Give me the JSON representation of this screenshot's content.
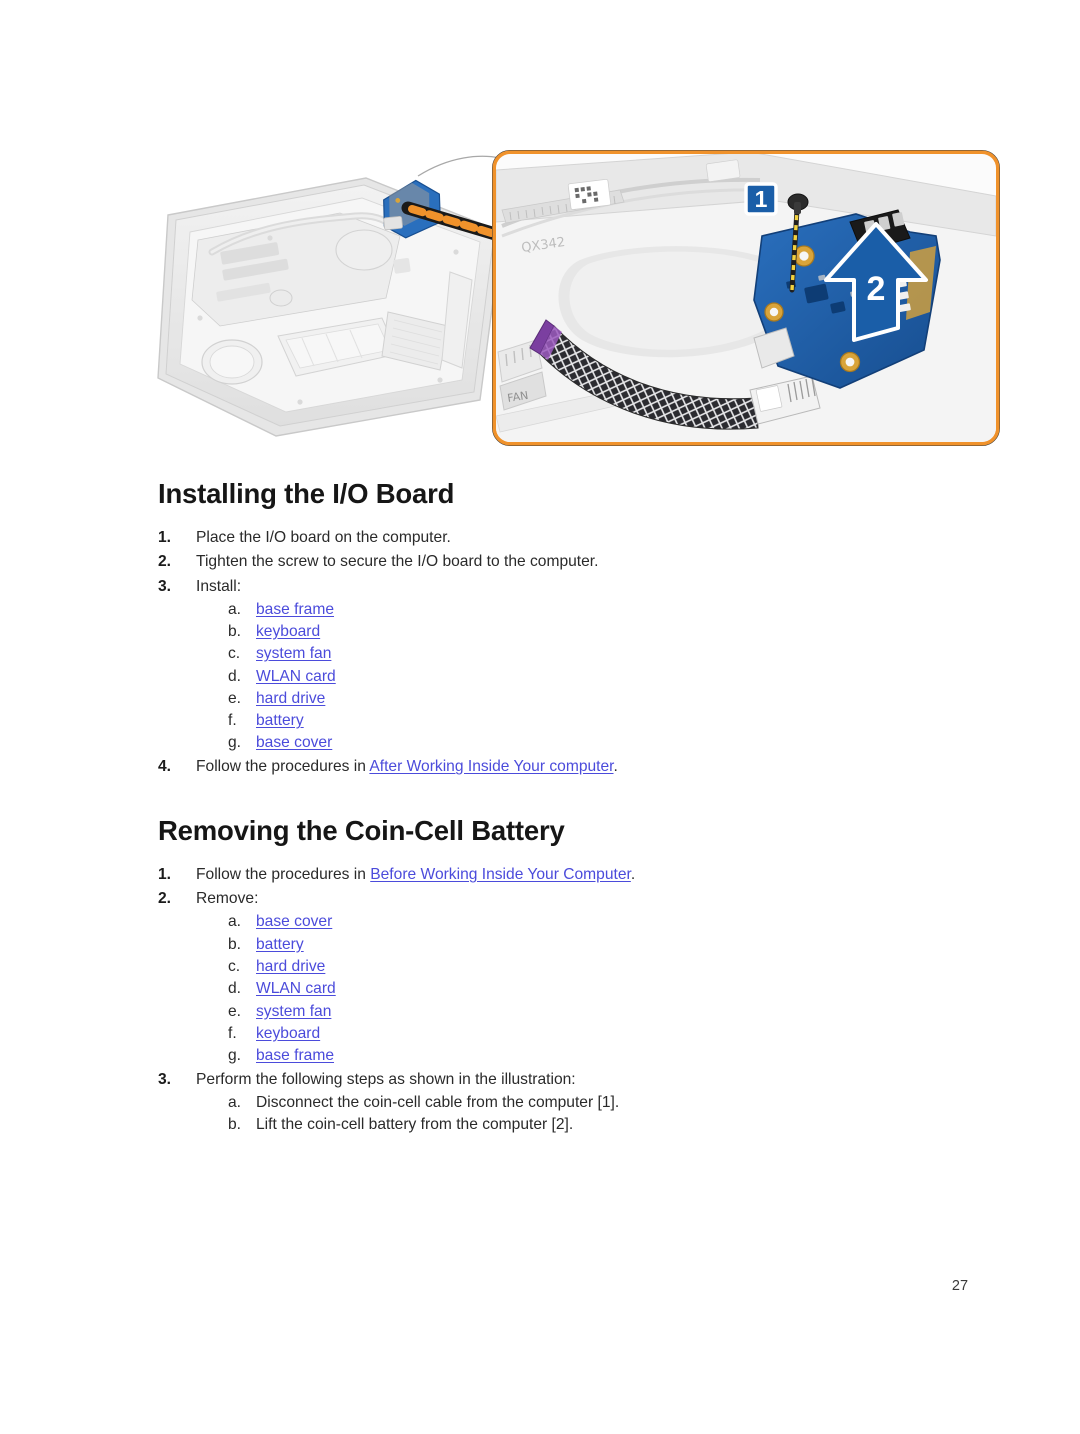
{
  "figure": {
    "alt_description": "Exploded view of laptop base with magnified callout of the coin-cell battery / I-O board area",
    "callout_border_color": "#f0922b",
    "pcb_color": "#1e5fa8",
    "marker_color": "#1a5ea8",
    "markers": [
      {
        "id": "1",
        "label": "1",
        "type": "square-badge"
      },
      {
        "id": "2",
        "label": "2",
        "type": "arrow-up"
      }
    ],
    "chassis_labels": [
      "FAN"
    ]
  },
  "sections": [
    {
      "id": "installing-io-board",
      "title": "Installing the I/O Board",
      "steps": [
        {
          "num": "1.",
          "text": "Place the I/O board on the computer."
        },
        {
          "num": "2.",
          "text": "Tighten the screw to secure the I/O board to the computer."
        },
        {
          "num": "3.",
          "text": "Install:",
          "substeps": [
            {
              "lettr": "a.",
              "text": "base frame",
              "link": true
            },
            {
              "lettr": "b.",
              "text": "keyboard",
              "link": true
            },
            {
              "lettr": "c.",
              "text": "system fan",
              "link": true
            },
            {
              "lettr": "d.",
              "text": "WLAN card",
              "link": true
            },
            {
              "lettr": "e.",
              "text": "hard drive",
              "link": true
            },
            {
              "lettr": "f.",
              "text": "battery",
              "link": true
            },
            {
              "lettr": "g.",
              "text": "base cover",
              "link": true
            }
          ]
        },
        {
          "num": "4.",
          "prefix": "Follow the procedures in ",
          "link_text": "After Working Inside Your computer",
          "suffix": "."
        }
      ]
    },
    {
      "id": "removing-coin-cell-battery",
      "title": "Removing the Coin-Cell Battery",
      "steps": [
        {
          "num": "1.",
          "prefix": "Follow the procedures in ",
          "link_text": "Before Working Inside Your Computer",
          "suffix": "."
        },
        {
          "num": "2.",
          "text": "Remove:",
          "substeps": [
            {
              "lettr": "a.",
              "text": "base cover",
              "link": true
            },
            {
              "lettr": "b.",
              "text": "battery",
              "link": true
            },
            {
              "lettr": "c.",
              "text": "hard drive",
              "link": true
            },
            {
              "lettr": "d.",
              "text": "WLAN card",
              "link": true
            },
            {
              "lettr": "e.",
              "text": "system fan",
              "link": true
            },
            {
              "lettr": "f.",
              "text": "keyboard",
              "link": true
            },
            {
              "lettr": "g.",
              "text": "base frame",
              "link": true
            }
          ]
        },
        {
          "num": "3.",
          "text": "Perform the following steps as shown in the illustration:",
          "substeps": [
            {
              "lettr": "a.",
              "text": "Disconnect the coin-cell cable from the computer [1].",
              "link": false
            },
            {
              "lettr": "b.",
              "text": "Lift the coin-cell battery from the computer [2].",
              "link": false
            }
          ]
        }
      ]
    }
  ],
  "footer": {
    "page_number": "27"
  }
}
